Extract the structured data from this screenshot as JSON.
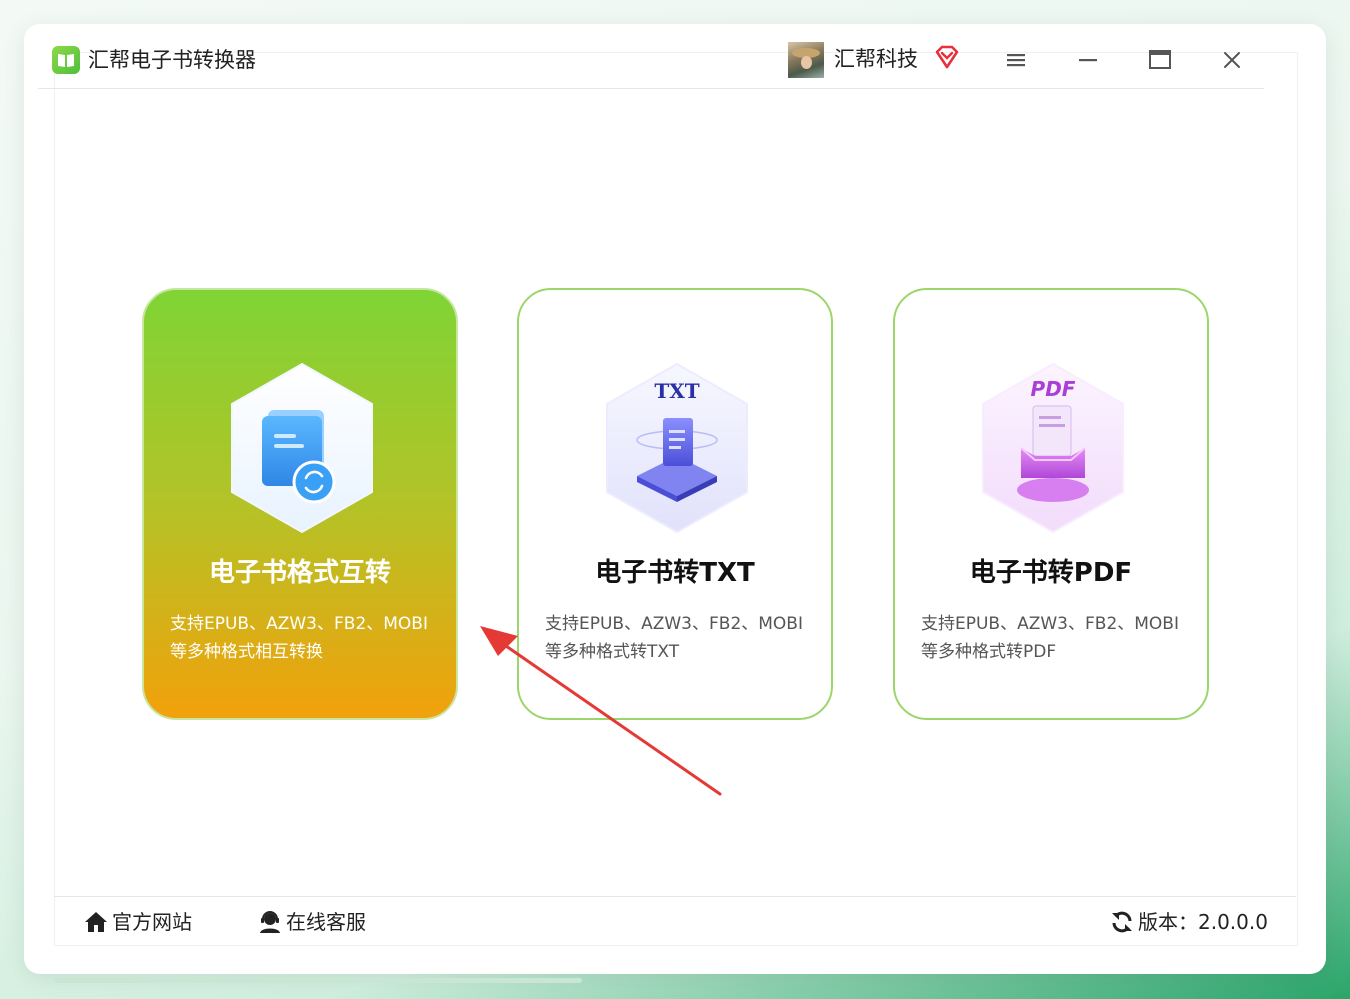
{
  "app": {
    "title": "汇帮电子书转换器",
    "logo_icon": "book-logo-icon",
    "accent_color": "#7fd435"
  },
  "header": {
    "company": "汇帮科技",
    "vip_icon": "vip-diamond-icon",
    "vip_color": "#e8303a",
    "menu_icon": "menu-icon",
    "minimize_icon": "minimize-icon",
    "maximize_icon": "maximize-icon",
    "close_icon": "close-icon"
  },
  "cards": [
    {
      "title": "电子书格式互转",
      "desc_line1": "支持EPUB、AZW3、FB2、MOBI",
      "desc_line2": "等多种格式相互转换",
      "icon": "ebook-convert-icon"
    },
    {
      "title": "电子书转TXT",
      "icon_label": "TXT",
      "desc_line1": "支持EPUB、AZW3、FB2、MOBI",
      "desc_line2": "等多种格式转TXT",
      "icon": "txt-document-icon"
    },
    {
      "title": "电子书转PDF",
      "icon_label": "PDF",
      "desc_line1": "支持EPUB、AZW3、FB2、MOBI",
      "desc_line2": "等多种格式转PDF",
      "icon": "pdf-document-icon"
    }
  ],
  "annotation": {
    "arrow_color": "#e53935"
  },
  "footer": {
    "website_label": "官方网站",
    "support_label": "在线客服",
    "version_label": "版本：2.0.0.0"
  }
}
